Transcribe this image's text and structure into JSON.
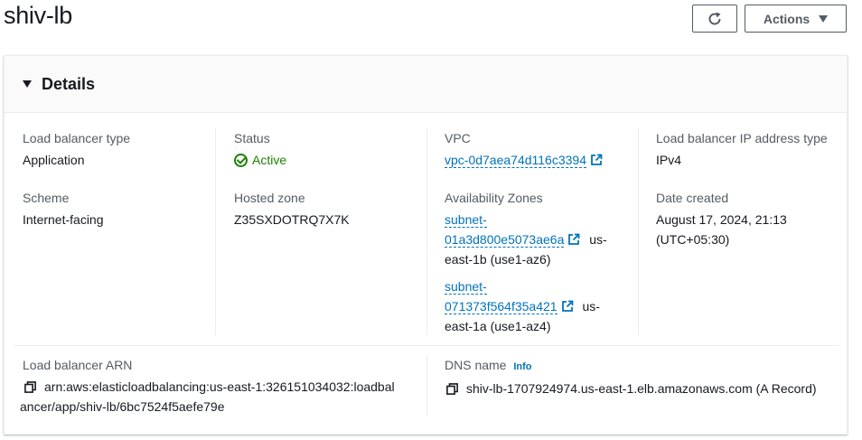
{
  "page": {
    "title": "shiv-lb"
  },
  "toolbar": {
    "refresh_icon": "refresh-icon",
    "actions_label": "Actions"
  },
  "details": {
    "header": "Details",
    "load_balancer_type": {
      "label": "Load balancer type",
      "value": "Application"
    },
    "status": {
      "label": "Status",
      "value": "Active",
      "color": "#1d8102"
    },
    "vpc": {
      "label": "VPC",
      "value": "vpc-0d7aea74d116c3394"
    },
    "ip_address_type": {
      "label": "Load balancer IP address type",
      "value": "IPv4"
    },
    "scheme": {
      "label": "Scheme",
      "value": "Internet-facing"
    },
    "hosted_zone": {
      "label": "Hosted zone",
      "value": "Z35SXDOTRQ7X7K"
    },
    "availability_zones": {
      "label": "Availability Zones",
      "items": [
        {
          "subnet_line1": "subnet-",
          "subnet_line2": "01a3d800e5073ae6a",
          "zone_suffix": "us-",
          "zone_line2": "east-1b (use1-az6)"
        },
        {
          "subnet_line1": "subnet-",
          "subnet_line2": "071373f564f35a421",
          "zone_suffix": "us-",
          "zone_line2": "east-1a (use1-az4)"
        }
      ]
    },
    "date_created": {
      "label": "Date created",
      "line1": "August 17, 2024, 21:13",
      "line2": "(UTC+05:30)"
    },
    "arn": {
      "label": "Load balancer ARN",
      "line1": "arn:aws:elasticloadbalancing:us-east-1:326151034032:loadbal",
      "line2": "ancer/app/shiv-lb/6bc7524f5aefe79e"
    },
    "dns": {
      "label": "DNS name",
      "info": "Info",
      "value": "shiv-lb-1707924974.us-east-1.elb.amazonaws.com (A Record)"
    }
  },
  "colors": {
    "link": "#0073bb",
    "success": "#1d8102",
    "label": "#545b64",
    "text": "#16191f"
  }
}
